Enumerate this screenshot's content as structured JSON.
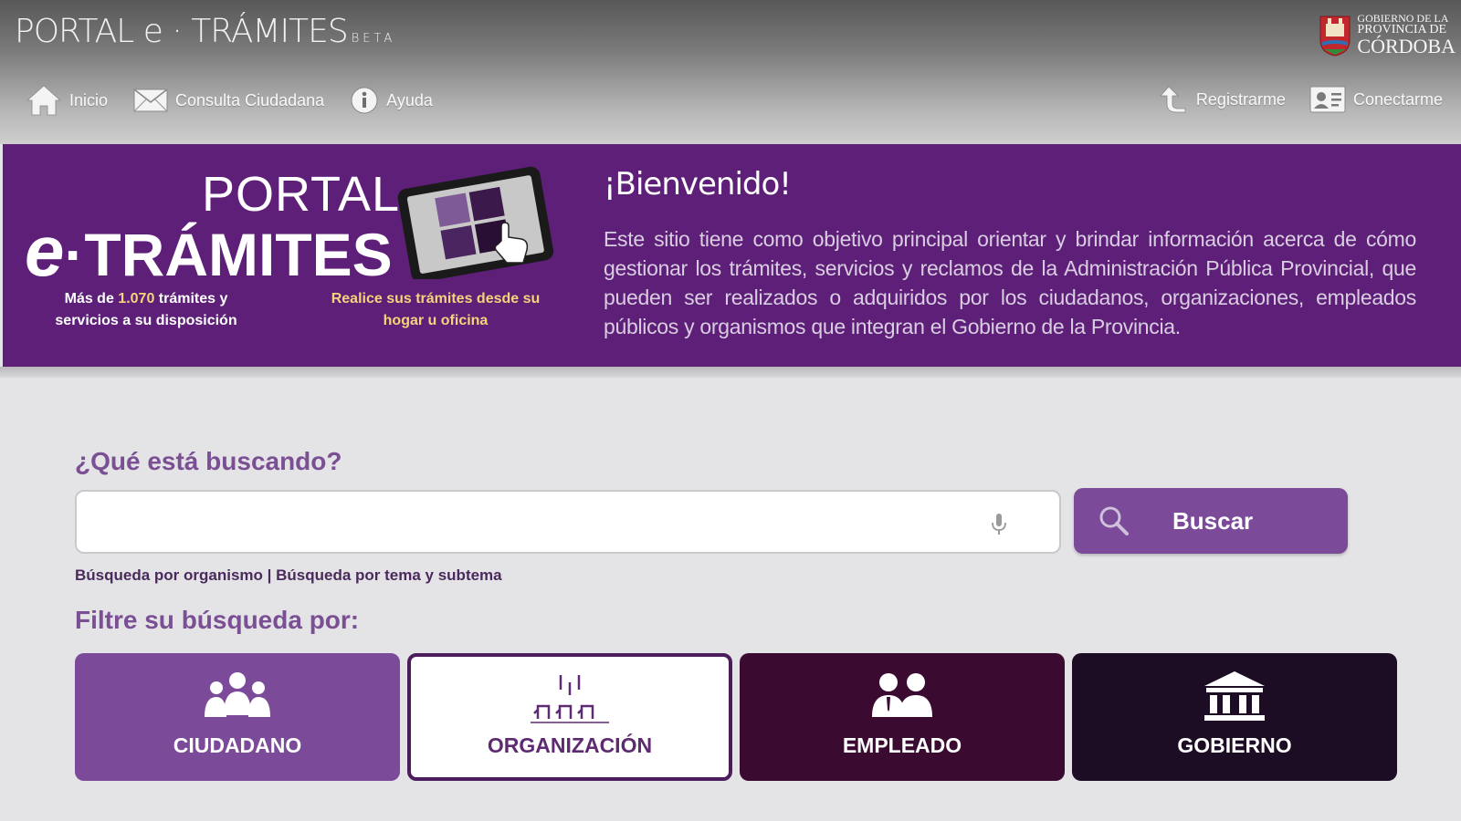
{
  "header": {
    "logo": {
      "main": "PORTAL e · TRÁMITES",
      "badge": "BETA"
    },
    "gov_logo": {
      "line1": "GOBIERNO DE LA",
      "line2": "PROVINCIA DE",
      "line3": "CÓRDOBA"
    },
    "nav_left": [
      {
        "label": "Inicio",
        "icon": "home-icon"
      },
      {
        "label": "Consulta Ciudadana",
        "icon": "envelope-icon"
      },
      {
        "label": "Ayuda",
        "icon": "info-icon"
      }
    ],
    "nav_right": [
      {
        "label": "Registrarme",
        "icon": "register-arrow-icon"
      },
      {
        "label": "Conectarme",
        "icon": "id-card-icon"
      }
    ]
  },
  "banner": {
    "portal_word": "PORTAL",
    "etramites_e": "e",
    "etramites_rest": "·TRÁMITES",
    "caption1_pre": "Más de ",
    "caption1_highlight": "1.070",
    "caption1_post": " trámites y servicios a su disposición",
    "caption2": "Realice sus trámites desde su hogar u oficina",
    "welcome_title": "¡Bienvenido!",
    "welcome_text": "Este sitio tiene como objetivo principal orientar y brindar información acerca de cómo gestionar los trámites, servicios y reclamos de la Administración Pública Provincial, que pueden ser realizados o adquiridos por los ciudadanos, organizaciones, empleados públicos y organismos que integran el Gobierno de la Provincia."
  },
  "search": {
    "label": "¿Qué está buscando?",
    "value": "",
    "placeholder": "",
    "button_label": "Buscar",
    "link_organismo": "Búsqueda por organismo",
    "separator": " | ",
    "link_tema": "Búsqueda por tema y subtema"
  },
  "filters": {
    "label": "Filtre su búsqueda por:",
    "items": [
      {
        "label": "CIUDADANO",
        "icon": "citizens-icon"
      },
      {
        "label": "ORGANIZACIÓN",
        "icon": "organization-icon"
      },
      {
        "label": "EMPLEADO",
        "icon": "employees-icon"
      },
      {
        "label": "GOBIERNO",
        "icon": "government-building-icon"
      }
    ]
  },
  "colors": {
    "banner": "#5e1f79",
    "accent": "#7b4a99",
    "highlight": "#f2d47a",
    "card_empleado": "#3a0a30",
    "card_gobierno": "#1d0d24"
  }
}
